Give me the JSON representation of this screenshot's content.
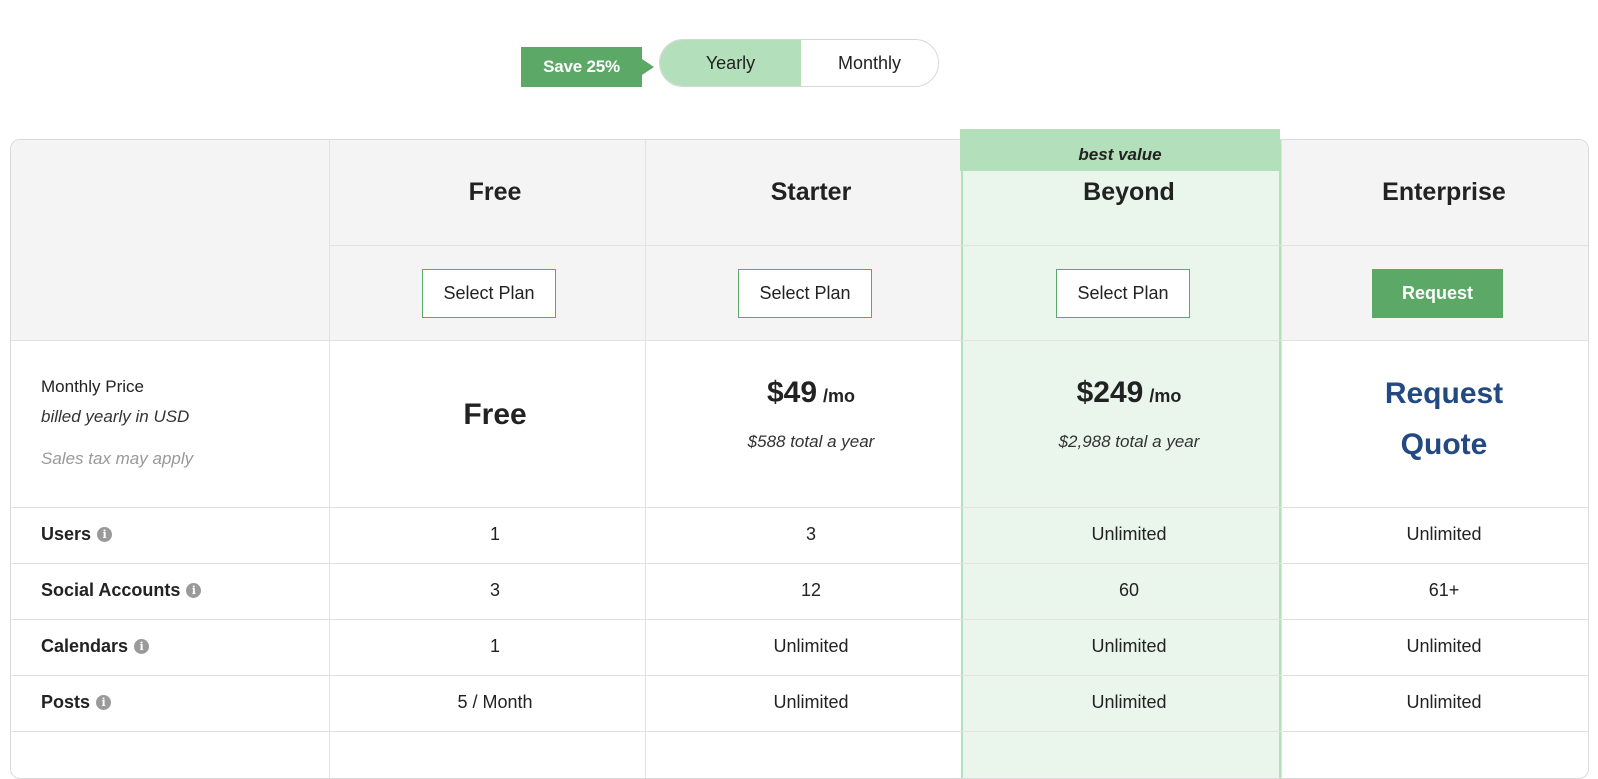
{
  "billing": {
    "save_badge": "Save 25%",
    "yearly_label": "Yearly",
    "monthly_label": "Monthly",
    "selected": "Yearly"
  },
  "best_value_label": "best value",
  "plans": [
    {
      "name": "Free",
      "button": "Select Plan"
    },
    {
      "name": "Starter",
      "button": "Select Plan"
    },
    {
      "name": "Beyond",
      "button": "Select Plan"
    },
    {
      "name": "Enterprise",
      "button": "Request"
    }
  ],
  "price_row": {
    "label": "Monthly Price",
    "billing_note": "billed yearly in USD",
    "tax_note": "Sales tax may apply",
    "free": "Free",
    "starter_amount": "$49",
    "starter_per": "/mo",
    "starter_total": "$588 total a year",
    "beyond_amount": "$249",
    "beyond_per": "/mo",
    "beyond_total": "$2,988 total a year",
    "enterprise_line1": "Request",
    "enterprise_line2": "Quote"
  },
  "features": [
    {
      "label": "Users",
      "values": [
        "1",
        "3",
        "Unlimited",
        "Unlimited"
      ]
    },
    {
      "label": "Social Accounts",
      "values": [
        "3",
        "12",
        "60",
        "61+"
      ]
    },
    {
      "label": "Calendars",
      "values": [
        "1",
        "Unlimited",
        "Unlimited",
        "Unlimited"
      ]
    },
    {
      "label": "Posts",
      "values": [
        "5 / Month",
        "Unlimited",
        "Unlimited",
        "Unlimited"
      ]
    }
  ],
  "info_icon_glyph": "i",
  "colors": {
    "accent": "#5ba867",
    "highlight": "#b3dfba",
    "highlight_bg": "#eaf6ec",
    "quote": "#234a80"
  }
}
